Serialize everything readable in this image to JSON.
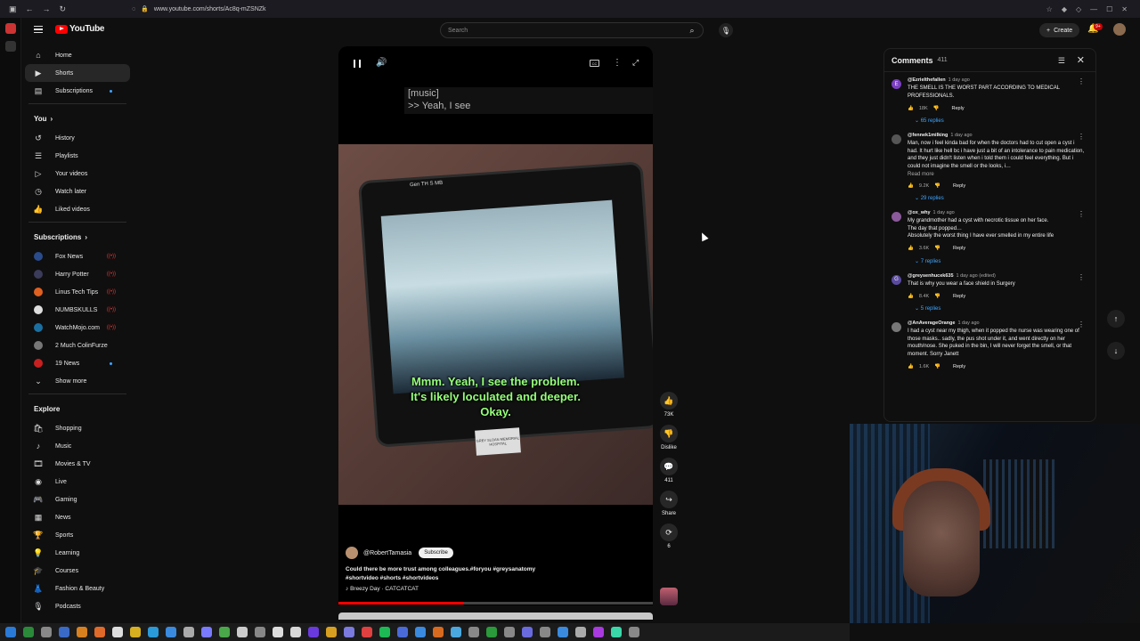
{
  "browser": {
    "url": "www.youtube.com/shorts/Ac8q-mZSNZk"
  },
  "header": {
    "logo_text": "YouTube",
    "search_placeholder": "Search",
    "create_label": "Create",
    "notification_count": "9+"
  },
  "sidebar": {
    "main": [
      {
        "label": "Home",
        "icon": "home-icon"
      },
      {
        "label": "Shorts",
        "icon": "shorts-icon",
        "active": true
      },
      {
        "label": "Subscriptions",
        "icon": "subscriptions-icon"
      }
    ],
    "you_title": "You",
    "you": [
      {
        "label": "History",
        "icon": "history-icon"
      },
      {
        "label": "Playlists",
        "icon": "playlists-icon"
      },
      {
        "label": "Your videos",
        "icon": "your-videos-icon"
      },
      {
        "label": "Watch later",
        "icon": "watch-later-icon"
      },
      {
        "label": "Liked videos",
        "icon": "liked-videos-icon"
      }
    ],
    "subs_title": "Subscriptions",
    "subscriptions": [
      {
        "label": "Fox News",
        "color": "#2a4b8c",
        "live": true
      },
      {
        "label": "Harry Potter",
        "color": "#3b3b5a",
        "live": true
      },
      {
        "label": "Linus Tech Tips",
        "color": "#e06020",
        "live": true
      },
      {
        "label": "NUMBSKULLS",
        "color": "#dddddd",
        "live": true
      },
      {
        "label": "WatchMojo.com",
        "color": "#1b6fa0",
        "live": true
      },
      {
        "label": "2 Much ColinFurze",
        "color": "#777777"
      },
      {
        "label": "19 News",
        "color": "#c82020",
        "new": true
      }
    ],
    "show_more": "Show more",
    "explore_title": "Explore",
    "explore": [
      {
        "label": "Shopping",
        "icon": "shopping-icon"
      },
      {
        "label": "Music",
        "icon": "music-icon"
      },
      {
        "label": "Movies & TV",
        "icon": "movies-icon"
      },
      {
        "label": "Live",
        "icon": "live-icon"
      },
      {
        "label": "Gaming",
        "icon": "gaming-icon"
      },
      {
        "label": "News",
        "icon": "news-icon"
      },
      {
        "label": "Sports",
        "icon": "sports-icon"
      },
      {
        "label": "Learning",
        "icon": "learning-icon"
      },
      {
        "label": "Courses",
        "icon": "courses-icon"
      },
      {
        "label": "Fashion & Beauty",
        "icon": "fashion-icon"
      },
      {
        "label": "Podcasts",
        "icon": "podcasts-icon"
      }
    ]
  },
  "player": {
    "captions": [
      "[music]",
      ">> Yeah, I see"
    ],
    "burned_subtitle": [
      "Mmm. Yeah, I see the problem.",
      "It's likely loculated and deeper.",
      "Okay."
    ],
    "screen_label": "Gen TH S MB",
    "hospital_label": "GREY SLOAN MEMORIAL HOSPITAL",
    "channel": "@RobertTamasia",
    "subscribe": "Subscribe",
    "description": "Could there be more trust among colleagues.#foryou #greysanatomy #shortvideo #shorts #shortvideos",
    "music": "Breezy Day · CATCATCAT",
    "progress": 0.4
  },
  "actions": {
    "likes": "73K",
    "dislike": "Dislike",
    "comments": "411",
    "share": "Share",
    "remix": "6"
  },
  "comments": {
    "title": "Comments",
    "count": "411",
    "reply_label": "Reply",
    "items": [
      {
        "author": "@Ezrielthefallen",
        "time": "1 day ago",
        "text": "THE SMELL IS THE WORST PART ACCORDING TO MEDICAL PROFESSIONALS.",
        "likes": "18K",
        "replies": "65 replies",
        "color": "#7a3fbf",
        "initial": "E"
      },
      {
        "author": "@fennek1milking",
        "time": "1 day ago",
        "text": "Man, now i feel kinda bad for when the doctors had to cut open a cyst i had. It hurt like hell bc i have just a bit of an intolerance to pain medication, and they just didn't listen when i told them i could feel everything. But i could not imagine the smell or the looks, i…",
        "readmore": "Read more",
        "likes": "9.2K",
        "replies": "29 replies",
        "color": "#555555",
        "initial": ""
      },
      {
        "author": "@ox_why",
        "time": "1 day ago",
        "text": "My grandmother had a cyst with necrotic tissue on her face.\nThe day that popped…\nAbsolutely the worst thing I have ever smelled in my entire life",
        "likes": "3.6K",
        "replies": "7 replies",
        "color": "#8a5a9a",
        "initial": ""
      },
      {
        "author": "@greysenhucek635",
        "time": "1 day ago (edited)",
        "text": "That is why you wear a face shield in Surgery",
        "likes": "8.4K",
        "replies": "5 replies",
        "color": "#5a4aa0",
        "initial": "G"
      },
      {
        "author": "@AnAverageOrange",
        "time": "1 day ago",
        "text": "I had a cyst near my thigh, when it popped the nurse was wearing one of those masks.. sadly, the pus shot under it, and went directly on her mouth/nose. She puked in the bin, I will never forget the smell, or that moment. Sorry Janett",
        "likes": "1.6K",
        "replies": "",
        "color": "#777777",
        "initial": ""
      }
    ]
  }
}
